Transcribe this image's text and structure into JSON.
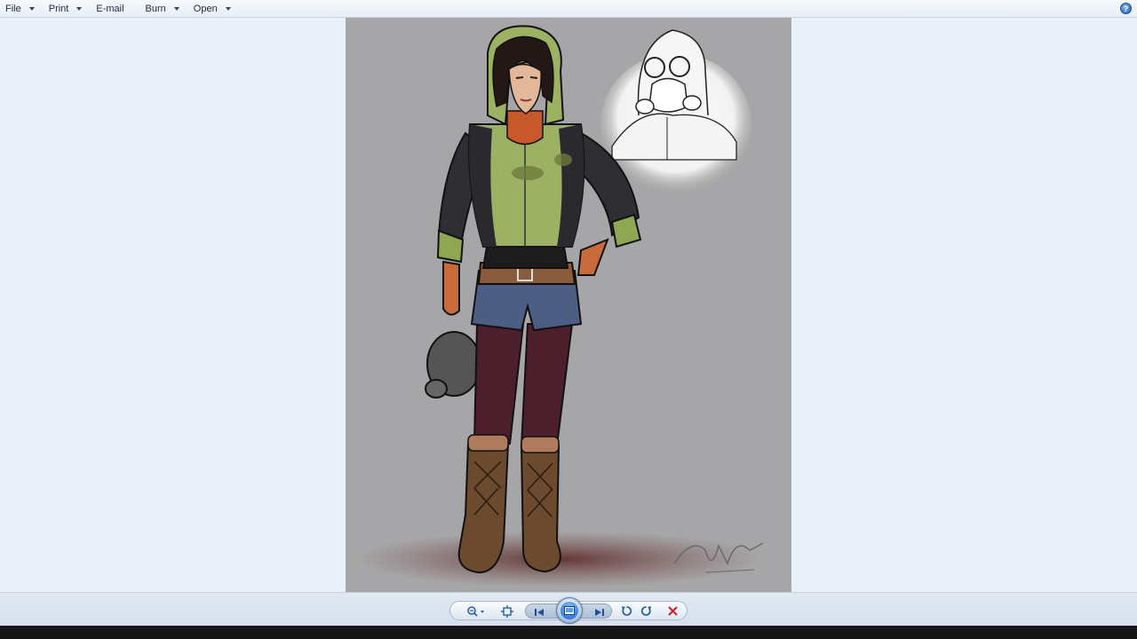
{
  "menu": {
    "items": [
      {
        "label": "File"
      },
      {
        "label": "Print"
      },
      {
        "label": "E-mail"
      },
      {
        "label": "Burn"
      },
      {
        "label": "Open"
      }
    ],
    "help_icon": "help-icon",
    "help_glyph": "?"
  },
  "image": {
    "subject": "character-concept-artwork",
    "background_color": "#a6a6a8"
  },
  "toolbar": {
    "zoom_icon": "zoom-icon",
    "fit_icon": "actual-size-icon",
    "previous_icon": "previous-icon",
    "slideshow_icon": "slideshow-icon",
    "next_icon": "next-icon",
    "rotate_ccw_icon": "rotate-counterclockwise-icon",
    "rotate_cw_icon": "rotate-clockwise-icon",
    "delete_icon": "delete-icon",
    "accent": "#2b5fa8",
    "delete_color": "#d01c1c"
  }
}
